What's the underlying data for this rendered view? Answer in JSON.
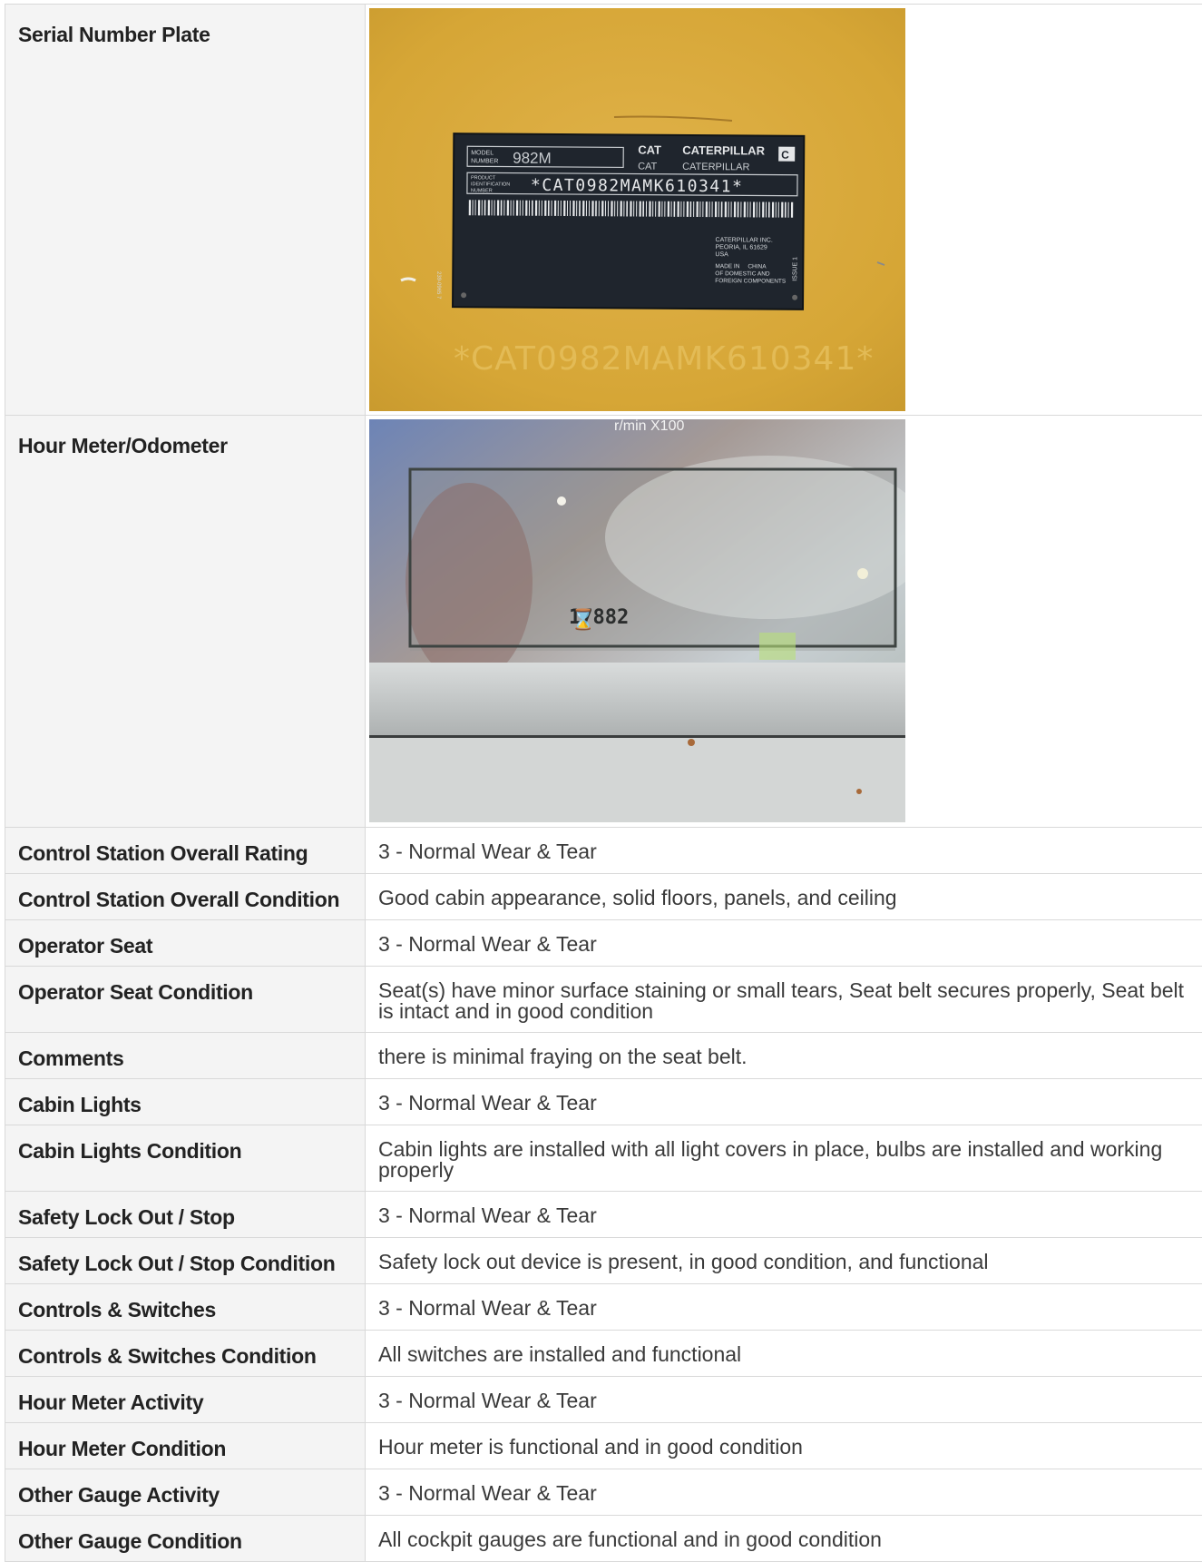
{
  "rows": [
    {
      "label": "Serial Number Plate",
      "type": "image"
    },
    {
      "label": "Hour Meter/Odometer",
      "type": "image"
    },
    {
      "label": "Control Station Overall Rating",
      "value": "3 - Normal Wear & Tear"
    },
    {
      "label": "Control Station Overall Condition",
      "value": "Good cabin appearance, solid floors, panels, and ceiling"
    },
    {
      "label": "Operator Seat",
      "value": "3 - Normal Wear & Tear"
    },
    {
      "label": "Operator Seat Condition",
      "value": "Seat(s) have minor surface staining or small tears, Seat belt secures properly, Seat belt is intact and in good condition"
    },
    {
      "label": "Comments",
      "value": "there is minimal fraying on the seat belt."
    },
    {
      "label": "Cabin Lights",
      "value": "3 - Normal Wear & Tear"
    },
    {
      "label": "Cabin Lights Condition",
      "value": "Cabin lights are installed with all light covers in place, bulbs are installed and working properly"
    },
    {
      "label": "Safety Lock Out / Stop",
      "value": "3 - Normal Wear & Tear"
    },
    {
      "label": "Safety Lock Out / Stop Condition",
      "value": "Safety lock out device is present, in good condition, and functional"
    },
    {
      "label": "Controls & Switches",
      "value": "3 - Normal Wear & Tear"
    },
    {
      "label": "Controls & Switches Condition",
      "value": "All switches are installed and functional"
    },
    {
      "label": "Hour Meter Activity",
      "value": "3 - Normal Wear & Tear"
    },
    {
      "label": "Hour Meter Condition",
      "value": "Hour meter is functional and in good condition"
    },
    {
      "label": "Other Gauge Activity",
      "value": "3 - Normal Wear & Tear"
    },
    {
      "label": "Other Gauge Condition",
      "value": "All cockpit gauges are functional and in good condition"
    }
  ],
  "plate": {
    "brand_small": "CAT",
    "brand": "CATERPILLAR",
    "model_label_1": "MODEL",
    "model_label_2": "NUMBER",
    "model": "982M",
    "pin_label_1": "PRODUCT",
    "pin_label_2": "IDENTIFICATION",
    "pin_label_3": "NUMBER",
    "pin": "*CAT0982MAMK610341*",
    "maker_1": "CATERPILLAR INC.",
    "maker_2": "PEORIA, IL 61629",
    "maker_3": "USA",
    "made_1": "MADE IN",
    "made_country": "CHINA",
    "made_2": "OF DOMESTIC AND",
    "made_3": "FOREIGN COMPONENTS",
    "issue": "ISSUE 1",
    "part_no": "239-0965 7",
    "stamp": "*CAT0982MAMK610341*"
  },
  "meter": {
    "top_label": "r/min  X100",
    "reading": "17882"
  },
  "colors": {
    "label_bg": "#f4f4f4",
    "border": "#d9d9d9",
    "plate_bg": "#d9a93a",
    "plate_dark": "#1c2128"
  }
}
